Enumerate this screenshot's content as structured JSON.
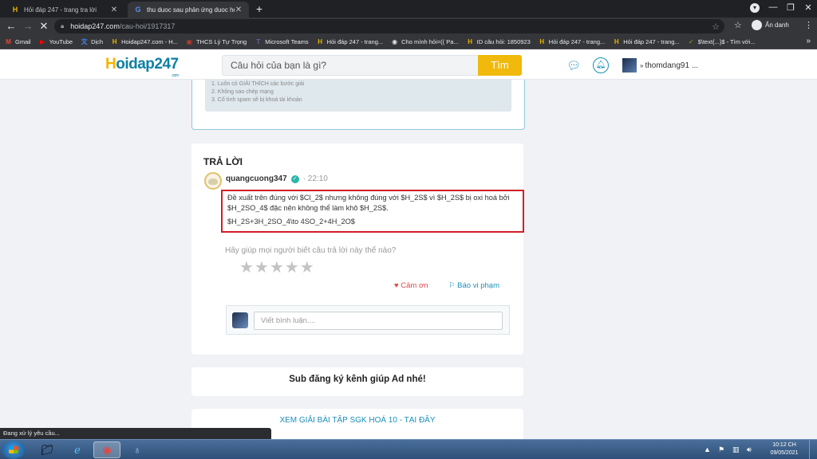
{
  "browser": {
    "tabs": [
      {
        "label": "Hỏi đáp 247 - trang tra lời",
        "favicon": "H"
      },
      {
        "label": "thu duoc sau phản ứng duoc hỏi",
        "favicon": "G"
      }
    ],
    "new_tab": "+",
    "url_host": "hoidap247.com",
    "url_path": "/cau-hoi/1917317",
    "profile_label": "Ẩn danh",
    "bookmarks": [
      {
        "label": "Gmail",
        "icon": "M",
        "color": "#ea4335"
      },
      {
        "label": "YouTube",
        "icon": "▶",
        "color": "#ff0000"
      },
      {
        "label": "Dịch",
        "icon": "文",
        "color": "#4285f4"
      },
      {
        "label": "Hoidap247.com - H...",
        "icon": "H",
        "color": "#e6b400"
      },
      {
        "label": "THCS Lý Tự Trọng",
        "icon": "▣",
        "color": "#c0392b"
      },
      {
        "label": "Microsoft Teams",
        "icon": "T",
        "color": "#6264a7"
      },
      {
        "label": "Hỏi đáp 247 - trang...",
        "icon": "H",
        "color": "#e6b400"
      },
      {
        "label": "Cho mình hỏi=(( Pa...",
        "icon": "◉",
        "color": "#e8eaed"
      },
      {
        "label": "ID câu hỏi: 1850923",
        "icon": "H",
        "color": "#e6b400"
      },
      {
        "label": "Hỏi đáp 247 - trang...",
        "icon": "H",
        "color": "#e6b400"
      },
      {
        "label": "Hỏi đáp 247 - trang...",
        "icon": "H",
        "color": "#e6b400"
      },
      {
        "label": "$\\text{...}$ - Tìm với...",
        "icon": "✓",
        "color": "#7fba00"
      }
    ]
  },
  "site": {
    "logo_h": "H",
    "logo_rest": "oidap247",
    "logo_sub": ".com",
    "search_placeholder": "Câu hỏi của bạn là gì?",
    "search_button": "Tìm",
    "username": "thomdang91 ..."
  },
  "rules": [
    "1. Luôn có GIẢI THÍCH các bước giải",
    "2. Không sao chép mạng",
    "3. Cố tình spam sẽ bị khoá tài khoản"
  ],
  "answer": {
    "heading": "TRẢ LỜI",
    "author": "quangcuong347",
    "time": "· 22:10",
    "text_line1": "Đề xuất trên đúng với $Cl_2$ nhưng không đúng với $H_2S$ vì $H_2S$ bị oxi hoá bởi $H_2SO_4$ đặc nên không thể làm khô $H_2S$.",
    "text_line2": "$H_2S+3H_2SO_4\\to 4SO_2+4H_2O$",
    "rate_question": "Hãy giúp mọi người biết câu trả lời này thế nào?",
    "rating_stars": 5,
    "rating_value": 0,
    "thanks_label": "Cảm ơn",
    "report_label": "Báo vi phạm",
    "comment_placeholder": "Viết bình luận...."
  },
  "promo": {
    "subscribe": "Sub đăng ký kênh giúp Ad nhé!",
    "sgk_link": "XEM GIẢI BÀI TẬP SGK HOÁ 10 - TẠI ĐÂY"
  },
  "status_text": "Đang xử lý yêu cầu...",
  "taskbar": {
    "time": "10:12 CH",
    "date": "09/05/2021"
  }
}
